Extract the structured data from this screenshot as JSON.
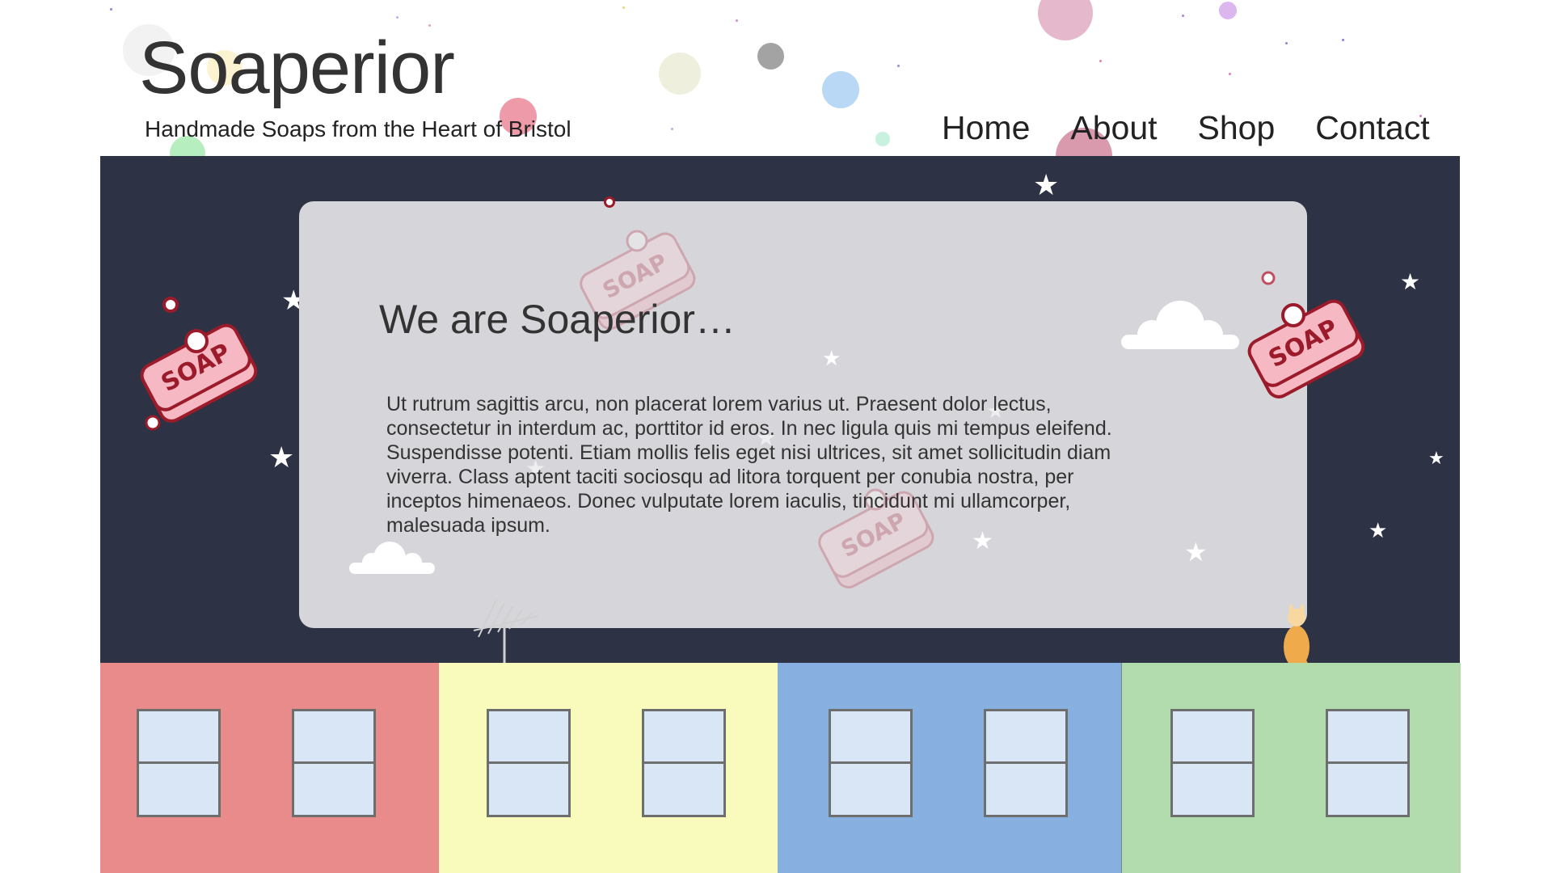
{
  "header": {
    "site_title": "Soaperior",
    "tagline": "Handmade Soaps from the Heart of Bristol"
  },
  "nav": {
    "items": [
      {
        "label": "Home"
      },
      {
        "label": "About"
      },
      {
        "label": "Shop"
      },
      {
        "label": "Contact"
      }
    ]
  },
  "hero": {
    "heading": "We are Soaperior…",
    "body": "Ut rutrum sagittis arcu, non placerat lorem varius ut. Praesent dolor lectus, consectetur in interdum ac, porttitor id eros. In nec ligula quis mi tempus eleifend. Suspendisse potenti. Etiam mollis felis eget nisi ultrices, sit amet sollicitudin diam viverra. Class aptent taciti sociosqu ad litora torquent per conubia nostra, per inceptos himenaeos. Donec vulputate lorem iaculis, tincidunt mi ullamcorper, malesuada ipsum.",
    "soap_label": "SOAP"
  },
  "colors": {
    "sky": "#2d3245",
    "card": "#d6d6da",
    "house_red": "#e88b8a",
    "house_yellow": "#f8fbbb",
    "house_blue": "#87afdf",
    "house_green": "#b3dcae",
    "soap_pink": "#f6b8c3",
    "soap_outline": "#9b1b2a",
    "cat": "#eeaa4b"
  }
}
